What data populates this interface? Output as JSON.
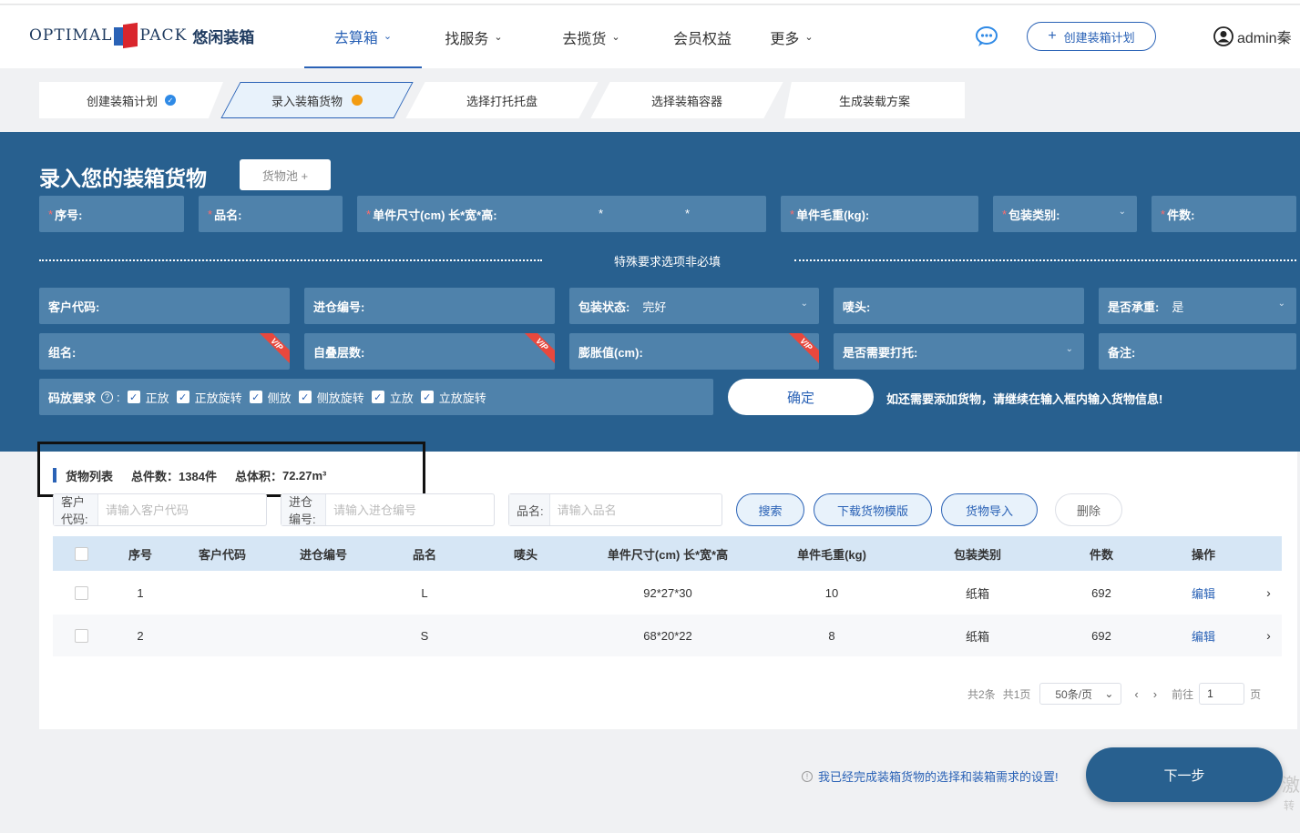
{
  "header": {
    "logo_text": "OPTIMAL",
    "logo_text2": "PACK",
    "logo_cn": "悠闲装箱",
    "nav": [
      {
        "label": "去算箱",
        "active": true,
        "dropdown": true
      },
      {
        "label": "找服务",
        "active": false,
        "dropdown": true
      },
      {
        "label": "去揽货",
        "active": false,
        "dropdown": true
      },
      {
        "label": "会员权益",
        "active": false,
        "dropdown": false
      },
      {
        "label": "更多",
        "active": false,
        "dropdown": true
      }
    ],
    "create_plan_label": "创建装箱计划",
    "user_name": "admin秦"
  },
  "steps": [
    {
      "label": "创建装箱计划",
      "state": "done"
    },
    {
      "label": "录入装箱货物",
      "state": "current"
    },
    {
      "label": "选择打托托盘",
      "state": "todo"
    },
    {
      "label": "选择装箱容器",
      "state": "todo"
    },
    {
      "label": "生成装载方案",
      "state": "todo"
    }
  ],
  "panel": {
    "title": "录入您的装箱货物",
    "pool_button": "货物池 +",
    "required_fields": {
      "seq": "序号:",
      "name": "品名:",
      "size": "单件尺寸(cm) 长*宽*高:",
      "size_sep1": "*",
      "size_sep2": "*",
      "weight": "单件毛重(kg):",
      "pack_type": "包装类别:",
      "count": "件数:"
    },
    "special_label": "特殊要求选项非必填",
    "optional_fields": {
      "customer_code": "客户代码:",
      "warehouse_no": "进仓编号:",
      "pack_state": "包装状态:",
      "pack_state_value": "完好",
      "mark": "唛头:",
      "load_bearing": "是否承重:",
      "load_bearing_value": "是",
      "group_name": "组名:",
      "stack_layers": "自叠层数:",
      "expansion": "膨胀值(cm):",
      "need_pallet": "是否需要打托:",
      "remark": "备注:"
    },
    "vip_label": "VIP",
    "placement_label": "码放要求",
    "placement_options": [
      "正放",
      "正放旋转",
      "侧放",
      "侧放旋转",
      "立放",
      "立放旋转"
    ],
    "confirm_button": "确定",
    "hint": "如还需要添加货物，请继续在输入框内输入货物信息!"
  },
  "list": {
    "title": "货物列表",
    "total_count_label": "总件数：",
    "total_count": "1384件",
    "total_volume_label": "总体积：",
    "total_volume": "72.27m³",
    "search": {
      "customer_label": "客户代码:",
      "customer_placeholder": "请输入客户代码",
      "warehouse_label": "进仓编号:",
      "warehouse_placeholder": "请输入进仓编号",
      "name_label": "品名:",
      "name_placeholder": "请输入品名"
    },
    "buttons": {
      "search": "搜索",
      "download": "下载货物模版",
      "import": "货物导入",
      "delete": "删除"
    },
    "columns": [
      "序号",
      "客户代码",
      "进仓编号",
      "品名",
      "唛头",
      "单件尺寸(cm) 长*宽*高",
      "单件毛重(kg)",
      "包装类别",
      "件数",
      "操作"
    ],
    "rows": [
      {
        "seq": "1",
        "customer": "",
        "warehouse": "",
        "name": "L",
        "mark": "",
        "size": "92*27*30",
        "weight": "10",
        "pack": "纸箱",
        "count": "692",
        "action": "编辑"
      },
      {
        "seq": "2",
        "customer": "",
        "warehouse": "",
        "name": "S",
        "mark": "",
        "size": "68*20*22",
        "weight": "8",
        "pack": "纸箱",
        "count": "692",
        "action": "编辑"
      }
    ],
    "pager": {
      "total": "共2条",
      "pages": "共1页",
      "page_size": "50条/页",
      "goto": "前往",
      "page": "1",
      "page_unit": "页"
    }
  },
  "footer": {
    "note": "我已经完成装箱货物的选择和装箱需求的设置!",
    "next_button": "下一步",
    "watermark": "激",
    "watermark2": "转"
  },
  "colors": {
    "primary": "#2a62b6",
    "panel": "#28608f",
    "field": "#4f82ab",
    "vip": "#e8483d",
    "step_dot": "#f39c12"
  }
}
